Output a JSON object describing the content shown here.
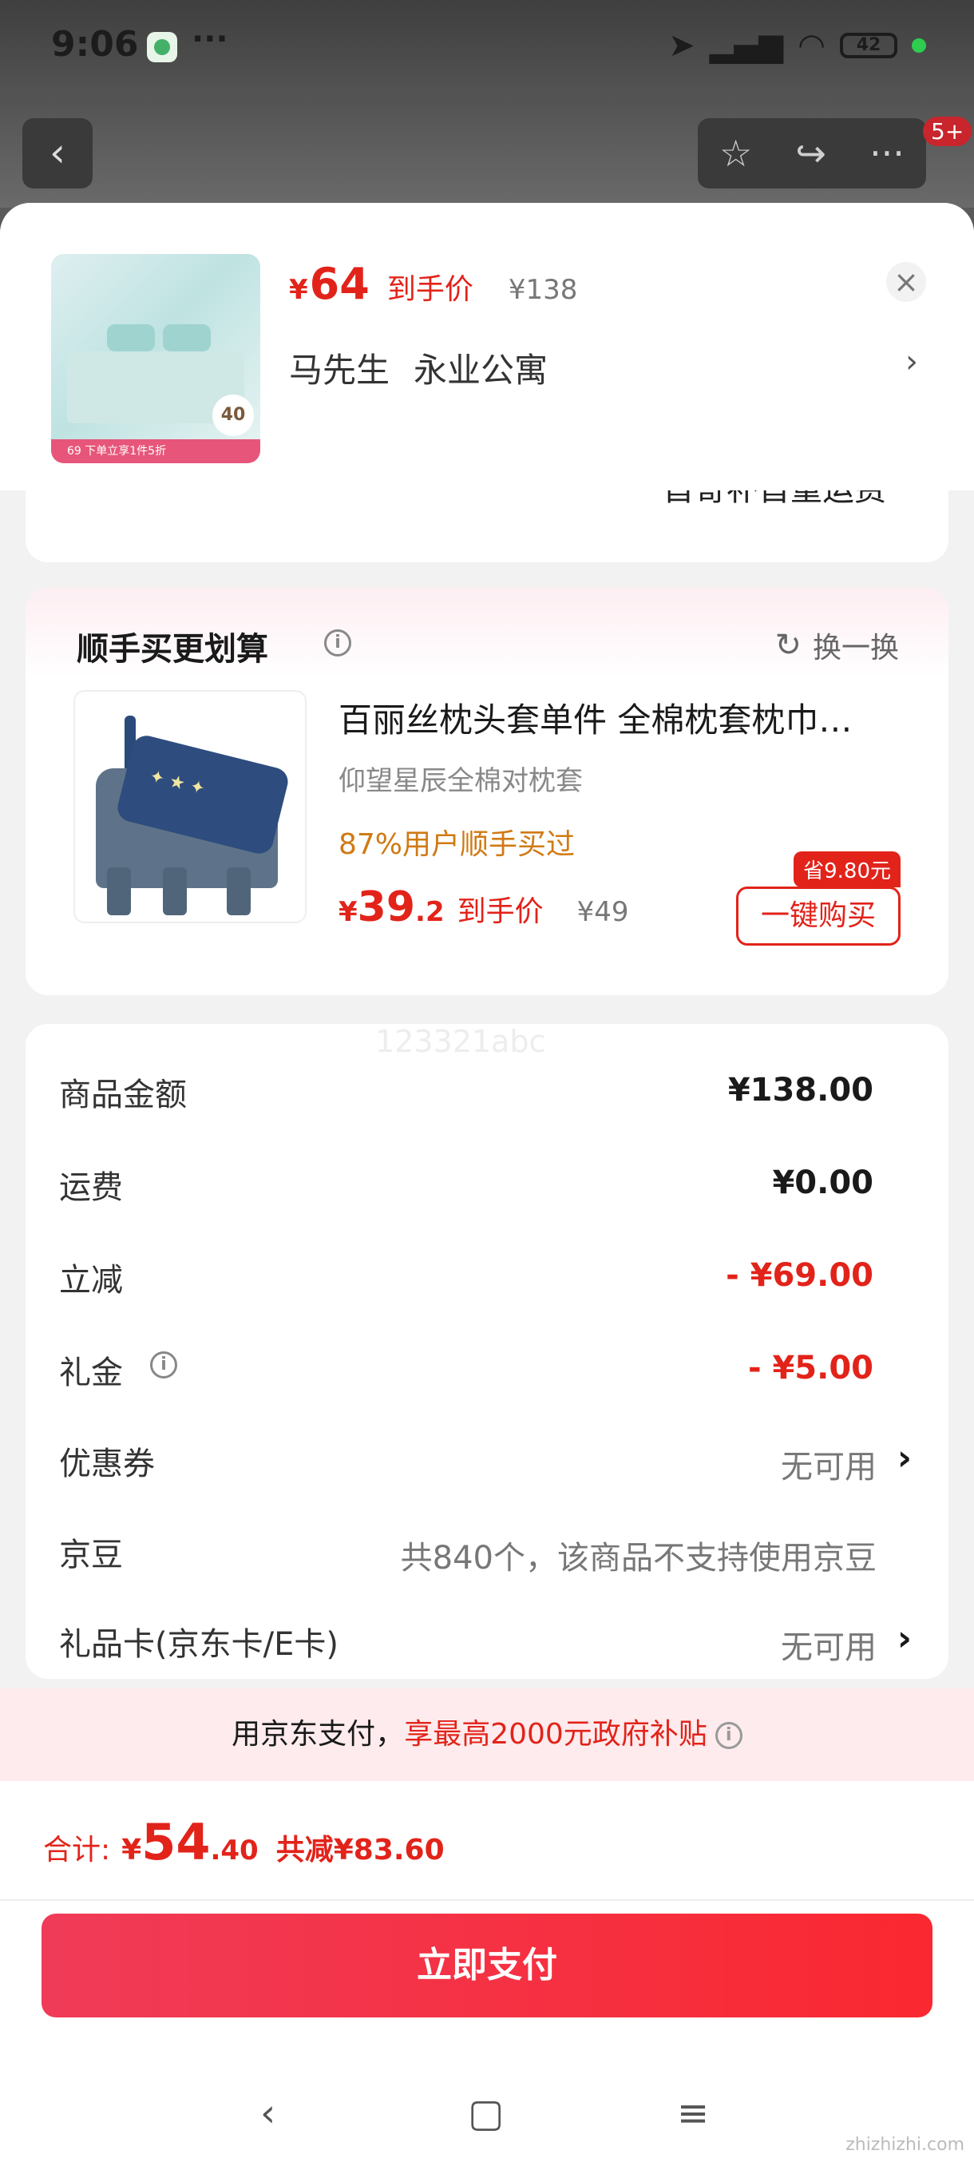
{
  "status_bar": {
    "time": "9:06",
    "more": "···",
    "battery": "42"
  },
  "nav": {
    "badge": "5+"
  },
  "summary": {
    "currency": "¥",
    "price": "64",
    "price_tag": "到手价",
    "original_price": "¥138",
    "name": "马先生",
    "address": "永业公寓",
    "thumb_badge": "40",
    "thumb_strip": "69     下单立享1件5折"
  },
  "card1_cut_text": "首寄补首重运费",
  "recommend": {
    "title": "顺手买更划算",
    "swap_label": "换一换",
    "product_name": "百丽丝枕头套单件 全棉枕套枕巾…",
    "product_sub": "仰望星辰全棉对枕套",
    "buyers_note": "87%用户顺手买过",
    "currency": "¥",
    "price_int": "39",
    "price_dec": ".2",
    "price_tag": "到手价",
    "original_price": "¥49",
    "save_badge": "省9.80元",
    "buy_button": "一键购买"
  },
  "watermark": "123321abc",
  "fees": [
    {
      "label": "商品金额",
      "value": "¥138.00",
      "style": "bold"
    },
    {
      "label": "运费",
      "value": "¥0.00",
      "style": "bold"
    },
    {
      "label": "立减",
      "value": "- ¥69.00",
      "style": "red"
    },
    {
      "label": "礼金",
      "value": "- ¥5.00",
      "style": "red"
    },
    {
      "label": "优惠券",
      "value": "无可用",
      "style": "gray"
    },
    {
      "label": "京豆",
      "value": "共840个，该商品不支持使用京豆",
      "style": "gray"
    },
    {
      "label": "礼品卡(京东卡/E卡)",
      "value": "无可用",
      "style": "gray"
    }
  ],
  "subsidy": {
    "prefix": "用京东支付，",
    "highlight": "享最高2000元政府补贴"
  },
  "total": {
    "label": "合计:",
    "currency": "¥",
    "int": "54",
    "dec": ".40",
    "saved": "共减¥83.60"
  },
  "pay_button": "立即支付",
  "site_mark": "zhizhizhi.com",
  "colors": {
    "accent_red": "#e2231a",
    "orange_note": "#d07a14",
    "pay_gradient_start": "#f03b58",
    "pay_gradient_end": "#fa2830"
  }
}
